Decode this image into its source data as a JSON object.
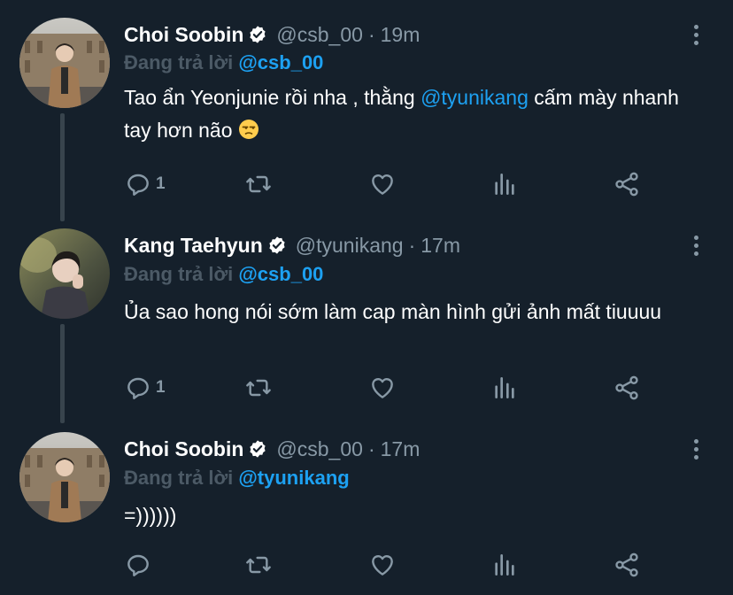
{
  "tweets": [
    {
      "name": "Choi Soobin",
      "handle": "@csb_00",
      "dot": "·",
      "time": "19m",
      "replying_prefix": "Đang trả lời",
      "replying_to": "@csb_00",
      "text_1": "Tao ẩn Yeonjunie rồi nha , thằng ",
      "mention": "@tyunikang",
      "text_2": " cấm mày nhanh tay hơn não",
      "emoji": "😒",
      "reply_count": "1"
    },
    {
      "name": "Kang Taehyun",
      "handle": "@tyunikang",
      "dot": "·",
      "time": "17m",
      "replying_prefix": "Đang trả lời",
      "replying_to": "@csb_00",
      "text": "Ủa sao hong nói sớm làm cap màn hình gửi ảnh mất tiuuuu",
      "reply_count": "1"
    },
    {
      "name": "Choi Soobin",
      "handle": "@csb_00",
      "dot": "·",
      "time": "17m",
      "replying_prefix": "Đang trả lời",
      "replying_to": "@tyunikang",
      "text": "=))))))",
      "reply_count": ""
    }
  ],
  "colors": {
    "background": "#15202b",
    "secondary_text": "#8899a6",
    "accent": "#1da1f2",
    "thread_line": "#38444d"
  },
  "icons": [
    "verified-badge-icon",
    "more-icon",
    "reply-icon",
    "retweet-icon",
    "like-icon",
    "analytics-icon",
    "share-icon"
  ]
}
